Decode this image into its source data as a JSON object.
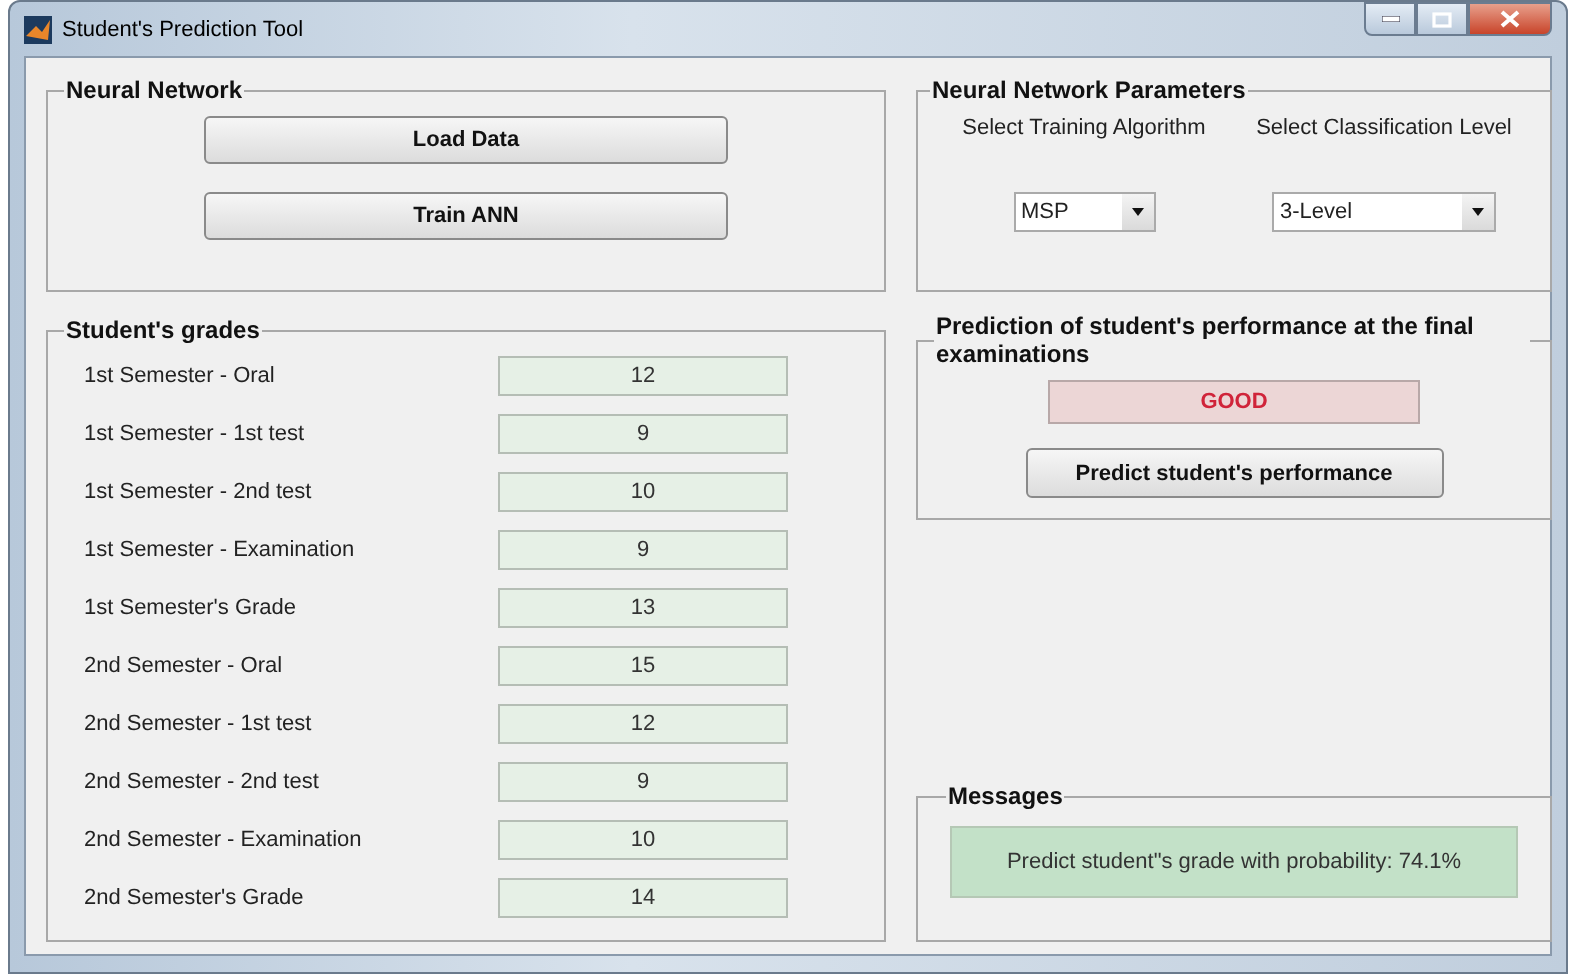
{
  "window": {
    "title": "Student's Prediction Tool"
  },
  "neural_network": {
    "title": "Neural Network",
    "buttons": [
      "Load Data",
      "Train ANN"
    ]
  },
  "parameters": {
    "title": "Neural Network Parameters",
    "selects": [
      {
        "label": "Select Training Algorithm",
        "value": "MSP"
      },
      {
        "label": "Select Classification Level",
        "value": "3-Level"
      }
    ]
  },
  "grades": {
    "title": "Student's grades",
    "rows": [
      {
        "label": "1st Semester - Oral",
        "value": "12"
      },
      {
        "label": "1st Semester - 1st test",
        "value": "9"
      },
      {
        "label": "1st Semester - 2nd test",
        "value": "10"
      },
      {
        "label": "1st Semester - Examination",
        "value": "9"
      },
      {
        "label": "1st Semester's Grade",
        "value": "13"
      },
      {
        "label": "2nd Semester - Oral",
        "value": "15"
      },
      {
        "label": "2nd Semester - 1st test",
        "value": "12"
      },
      {
        "label": "2nd Semester - 2nd test",
        "value": "9"
      },
      {
        "label": "2nd Semester - Examination",
        "value": "10"
      },
      {
        "label": "2nd Semester's Grade",
        "value": "14"
      }
    ]
  },
  "prediction": {
    "title": "Prediction of student's performance at the final examinations",
    "result": "GOOD",
    "button": "Predict student's performance"
  },
  "messages": {
    "title": "Messages",
    "text": "Predict student\"s grade with probability: 74.1%"
  }
}
